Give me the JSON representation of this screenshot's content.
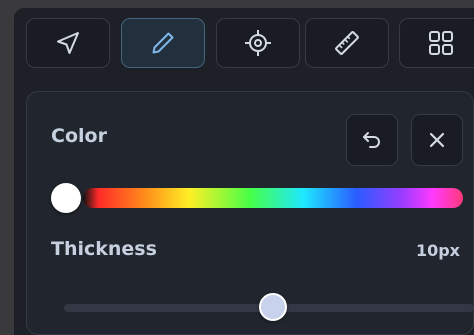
{
  "toolbar": {
    "tools": [
      {
        "icon": "navigate-icon",
        "active": false
      },
      {
        "icon": "pencil-icon",
        "active": true
      },
      {
        "icon": "crosshair-icon",
        "active": false
      },
      {
        "icon": "ruler-icon",
        "active": false
      },
      {
        "icon": "grid-icon",
        "active": false
      }
    ]
  },
  "panel": {
    "color_label": "Color",
    "thickness_label": "Thickness",
    "thickness_value": "10px",
    "thickness_fraction": 0.51,
    "hue_fraction": 0.0,
    "buttons": {
      "undo_icon": "undo-icon",
      "close_icon": "close-icon"
    }
  },
  "colors": {
    "background": "#1d2027",
    "panel": "#21252d",
    "text": "#c6d0df",
    "accent_border": "#45647d",
    "slider_thumb": "#c9d2ec"
  }
}
